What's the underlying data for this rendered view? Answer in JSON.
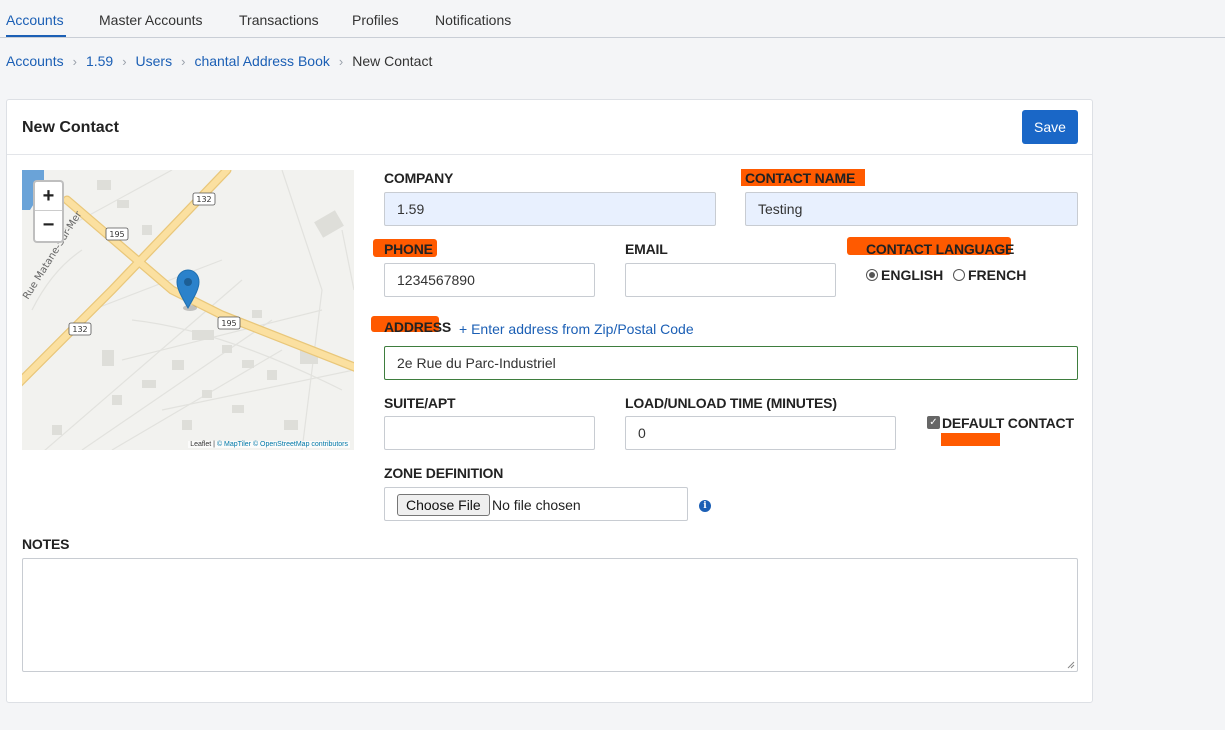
{
  "topnav": {
    "tabs": [
      {
        "label": "Accounts"
      },
      {
        "label": "Master Accounts"
      },
      {
        "label": "Transactions"
      },
      {
        "label": "Profiles"
      },
      {
        "label": "Notifications"
      }
    ],
    "active_tab": "Accounts"
  },
  "breadcrumb": {
    "items": [
      "Accounts",
      "1.59",
      "Users",
      "chantal Address Book"
    ],
    "current": "New Contact",
    "separator": "›"
  },
  "card": {
    "title": "New Contact",
    "save_label": "Save"
  },
  "map": {
    "zoom_in": "+",
    "zoom_out": "−",
    "road_labels": [
      "132",
      "195",
      "132",
      "195"
    ],
    "street_label": "Rue Matane-Sur-Mer",
    "attribution": {
      "leaflet": "Leaflet",
      "sep": " | ",
      "credits": "© MapTiler © OpenStreetMap contributors"
    },
    "marker_icon": "map-pin-icon"
  },
  "form": {
    "company": {
      "label": "COMPANY",
      "value": "1.59"
    },
    "contact_name": {
      "label": "CONTACT NAME",
      "value": "Testing"
    },
    "phone": {
      "label": "PHONE",
      "value": "1234567890"
    },
    "email": {
      "label": "EMAIL",
      "value": ""
    },
    "contact_language": {
      "label": "CONTACT LANGUAGE",
      "options": [
        "ENGLISH",
        "FRENCH"
      ],
      "selected": "ENGLISH"
    },
    "address": {
      "label": "ADDRESS",
      "zip_link": "+ Enter address from Zip/Postal Code",
      "value": "2e Rue du Parc-Industriel"
    },
    "suite": {
      "label": "SUITE/APT",
      "value": ""
    },
    "load_time": {
      "label": "LOAD/UNLOAD TIME (MINUTES)",
      "value": "0"
    },
    "default_contact": {
      "label": "DEFAULT CONTACT",
      "checked": true
    },
    "zone_definition": {
      "label": "ZONE DEFINITION",
      "button": "Choose File",
      "status": "No file chosen",
      "info_icon": "info-icon"
    },
    "notes": {
      "label": "NOTES",
      "value": ""
    }
  },
  "colors": {
    "accent": "#1a67c7",
    "highlight": "#ff5a00",
    "autofill_bg": "#e8f0fe",
    "valid_border": "#3e7d3e"
  }
}
